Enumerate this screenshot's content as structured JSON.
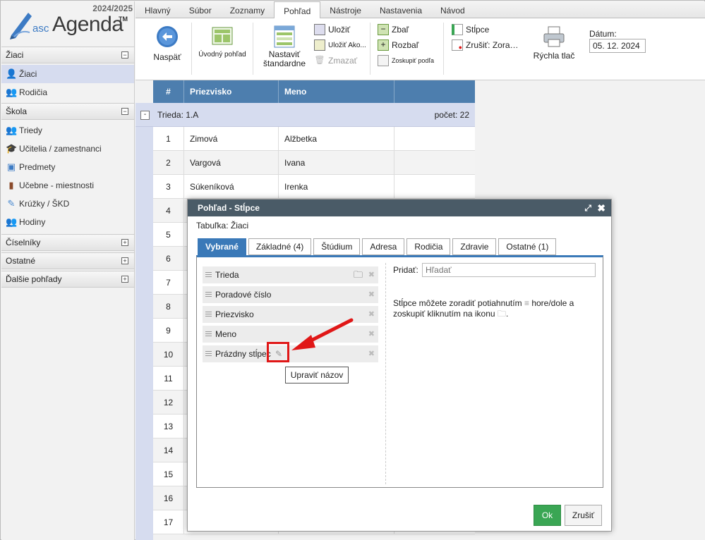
{
  "app": {
    "year": "2024/2025",
    "logo_prefix": "asc",
    "logo_name": "Agenda",
    "logo_tm": "TM"
  },
  "sidebar": {
    "sections": [
      {
        "label": "Žiaci",
        "toggle": "−",
        "items": [
          {
            "label": "Žiaci",
            "icon": "student-icon",
            "selected": true
          },
          {
            "label": "Rodičia",
            "icon": "parents-icon"
          }
        ]
      },
      {
        "label": "Škola",
        "toggle": "−",
        "items": [
          {
            "label": "Triedy",
            "icon": "classes-icon"
          },
          {
            "label": "Učitelia / zamestnanci",
            "icon": "graduation-cap-icon"
          },
          {
            "label": "Predmety",
            "icon": "book-icon"
          },
          {
            "label": "Učebne - miestnosti",
            "icon": "door-icon"
          },
          {
            "label": "Krúžky / ŠKD",
            "icon": "pencil-group-icon"
          },
          {
            "label": "Hodiny",
            "icon": "clock-people-icon"
          }
        ]
      },
      {
        "label": "Číselníky",
        "toggle": "+"
      },
      {
        "label": "Ostatné",
        "toggle": "+"
      },
      {
        "label": "Ďalšie pohľady",
        "toggle": "+"
      }
    ]
  },
  "menu": {
    "tabs": [
      "Hlavný",
      "Súbor",
      "Zoznamy",
      "Pohľad",
      "Nástroje",
      "Nastavenia",
      "Návod"
    ],
    "active": "Pohľad"
  },
  "ribbon": {
    "back": "Naspäť",
    "home_view": "Úvodný pohľad",
    "set_default_1": "Nastaviť",
    "set_default_2": "štandardne",
    "save": "Uložiť",
    "save_as": "Uložiť Ako...",
    "delete": "Zmazať",
    "collapse": "Zbaľ",
    "expand": "Rozbaľ",
    "group_by": "Zoskupiť podľa",
    "columns": "Stĺpce",
    "cancel_sort": "Zrušiť: Zora…",
    "quick_print": "Rýchla tlač",
    "date_label": "Dátum:",
    "date_value": "05. 12. 2024"
  },
  "grid": {
    "headers": [
      "#",
      "Priezvisko",
      "Meno",
      ""
    ],
    "group_title": "Trieda: 1.A",
    "group_count": "počet: 22",
    "rows": [
      {
        "n": "1",
        "surname": "Zimová",
        "name": "Alžbetka"
      },
      {
        "n": "2",
        "surname": "Vargová",
        "name": "Ivana"
      },
      {
        "n": "3",
        "surname": "Súkeníková",
        "name": "Irenka"
      },
      {
        "n": "4",
        "surname": "",
        "name": ""
      },
      {
        "n": "5",
        "surname": "",
        "name": ""
      },
      {
        "n": "6",
        "surname": "",
        "name": ""
      },
      {
        "n": "7",
        "surname": "",
        "name": ""
      },
      {
        "n": "8",
        "surname": "",
        "name": ""
      },
      {
        "n": "9",
        "surname": "",
        "name": ""
      },
      {
        "n": "10",
        "surname": "",
        "name": ""
      },
      {
        "n": "11",
        "surname": "",
        "name": ""
      },
      {
        "n": "12",
        "surname": "",
        "name": ""
      },
      {
        "n": "13",
        "surname": "",
        "name": ""
      },
      {
        "n": "14",
        "surname": "",
        "name": ""
      },
      {
        "n": "15",
        "surname": "",
        "name": ""
      },
      {
        "n": "16",
        "surname": "",
        "name": ""
      },
      {
        "n": "17",
        "surname": "",
        "name": ""
      }
    ]
  },
  "dialog": {
    "title": "Pohľad - Stĺpce",
    "table_label": "Tabuľka: Žiaci",
    "tabs": [
      "Vybrané",
      "Základné (4)",
      "Štúdium",
      "Adresa",
      "Rodičia",
      "Zdravie",
      "Ostatné (1)"
    ],
    "columns": [
      "Trieda",
      "Poradové číslo",
      "Priezvisko",
      "Meno",
      "Prázdny stĺpec"
    ],
    "add_label": "Pridať:",
    "search_placeholder": "Hľadať",
    "hint_1": "Stĺpce môžete zoradiť potiahnutím",
    "hint_2": "hore/dole a zoskupiť kliknutím na ikonu",
    "ok": "Ok",
    "cancel": "Zrušiť",
    "tooltip": "Upraviť názov"
  },
  "colors": {
    "accent": "#3a79b8",
    "header": "#4d7eae",
    "ok": "#3aa654",
    "highlight": "#e01717"
  }
}
